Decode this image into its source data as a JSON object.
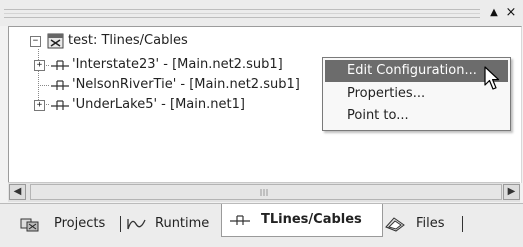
{
  "tree": {
    "root": {
      "label": "test: Tlines/Cables",
      "expander": "−"
    },
    "items": [
      {
        "label": "'Interstate23' - [Main.net2.sub1]",
        "expander": "+"
      },
      {
        "label": "'NelsonRiverTie' - [Main.net2.sub1]",
        "expander": ""
      },
      {
        "label": "'UnderLake5' - [Main.net1]",
        "expander": "+"
      }
    ]
  },
  "context_menu": {
    "items": [
      {
        "label": "Edit Configuration...",
        "highlighted": true
      },
      {
        "label": "Properties...",
        "highlighted": false
      },
      {
        "label": "Point to...",
        "highlighted": false
      }
    ]
  },
  "tabs": [
    {
      "label": "Projects",
      "icon": "projects-icon",
      "active": false
    },
    {
      "label": "Runtime",
      "icon": "runtime-icon",
      "active": false
    },
    {
      "label": "TLines/Cables",
      "icon": "cable-icon",
      "active": true
    },
    {
      "label": "Files",
      "icon": "files-icon",
      "active": false
    }
  ],
  "window_controls": {
    "pin": "▲",
    "close": "×"
  },
  "scrollbar": {
    "left_arrow": "◀",
    "right_arrow": "▶"
  }
}
